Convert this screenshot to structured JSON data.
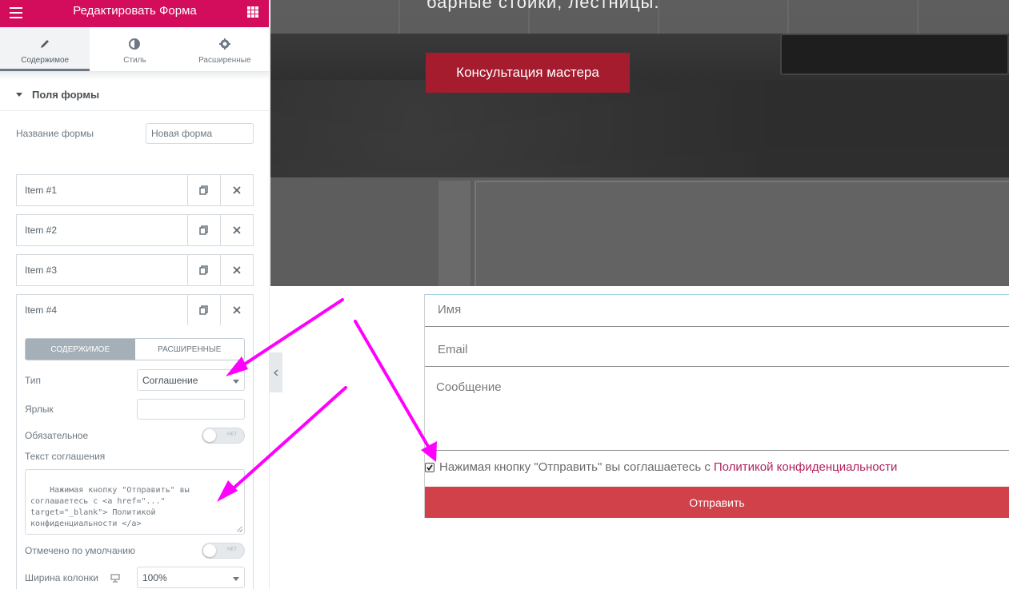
{
  "panel": {
    "title": "Редактировать Форма",
    "tabs": [
      {
        "label": "Содержимое",
        "icon": "pencil-icon"
      },
      {
        "label": "Стиль",
        "icon": "half-circle-icon"
      },
      {
        "label": "Расширенные",
        "icon": "gear-icon"
      }
    ],
    "section_title": "Поля формы",
    "form_name_label": "Название формы",
    "form_name_value": "Новая форма",
    "items": [
      "Item #1",
      "Item #2",
      "Item #3",
      "Item #4"
    ],
    "item4": {
      "seg_content": "СОДЕРЖИМОЕ",
      "seg_advanced": "РАСШИРЕННЫЕ",
      "type_label": "Тип",
      "type_value": "Соглашение",
      "label_label": "Ярлык",
      "label_value": "",
      "required_label": "Обязательное",
      "required_state": "НЕТ",
      "agreement_label": "Текст соглашения",
      "agreement_text": "Нажимая кнопку \"Отправить\" вы\nсоглашаетесь с <a href=\"...\"\ntarget=\"_blank\"> Политикой\nконфиденциальности </a>",
      "default_label": "Отмечено по умолчанию",
      "default_state": "НЕТ",
      "width_label": "Ширина колонки",
      "width_value": "100%"
    },
    "colors": {
      "brand": "#d30c5c"
    }
  },
  "preview": {
    "hero_tagline": "барные стойки, лестницы.",
    "cta_label": "Консультация мастера",
    "fields": {
      "name": "Имя",
      "email": "Email",
      "message": "Сообщение"
    },
    "agree_text": "Нажимая кнопку \"Отправить\" вы соглашаетесь с ",
    "agree_link": "Политикой конфиденциальности",
    "submit_label": "Отправить",
    "colors": {
      "cta": "#a51c2f",
      "submit": "#d0414a",
      "link": "#b0245c",
      "arrow": "#ff00ff"
    }
  }
}
